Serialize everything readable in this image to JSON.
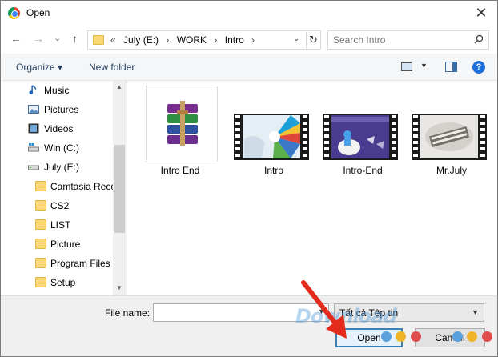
{
  "window": {
    "title": "Open",
    "close_glyph": "✕"
  },
  "nav": {
    "back": "←",
    "forward": "→",
    "recent": "⌄",
    "up": "↑"
  },
  "address": {
    "path": [
      "«",
      "July (E:)",
      "›",
      "WORK",
      "›",
      "Intro",
      "›"
    ],
    "refresh": "↻",
    "dropdown": "⌄"
  },
  "search": {
    "placeholder": "Search Intro"
  },
  "toolbar": {
    "organize": "Organize ▾",
    "new_folder": "New folder",
    "help": "?"
  },
  "sidebar": {
    "items": [
      {
        "label": "Music",
        "icon": "music-icon"
      },
      {
        "label": "Pictures",
        "icon": "pictures-icon"
      },
      {
        "label": "Videos",
        "icon": "videos-icon"
      },
      {
        "label": "Win (C:)",
        "icon": "drive-c-icon"
      },
      {
        "label": "July (E:)",
        "icon": "drive-e-icon"
      },
      {
        "label": "Camtasia Reco",
        "icon": "folder-icon"
      },
      {
        "label": "CS2",
        "icon": "folder-icon"
      },
      {
        "label": "LIST",
        "icon": "folder-icon"
      },
      {
        "label": "Picture",
        "icon": "folder-icon"
      },
      {
        "label": "Program Files",
        "icon": "folder-icon"
      },
      {
        "label": "Setup",
        "icon": "folder-icon"
      }
    ]
  },
  "files": [
    {
      "name": "Intro End",
      "type": "rar-archive"
    },
    {
      "name": "Intro",
      "type": "video"
    },
    {
      "name": "Intro-End",
      "type": "video"
    },
    {
      "name": "Mr.July",
      "type": "video"
    }
  ],
  "footer": {
    "file_name_label": "File name:",
    "file_name_value": "",
    "file_type": "Tất cả Tệp tin",
    "open_label": "Open",
    "cancel_label": "Cancel"
  },
  "overlay": {
    "watermark": "Download",
    "dot_colors": [
      "#5aa0dc",
      "#f0b429",
      "#e04b4b"
    ],
    "arrow_color": "#e32b1c"
  }
}
